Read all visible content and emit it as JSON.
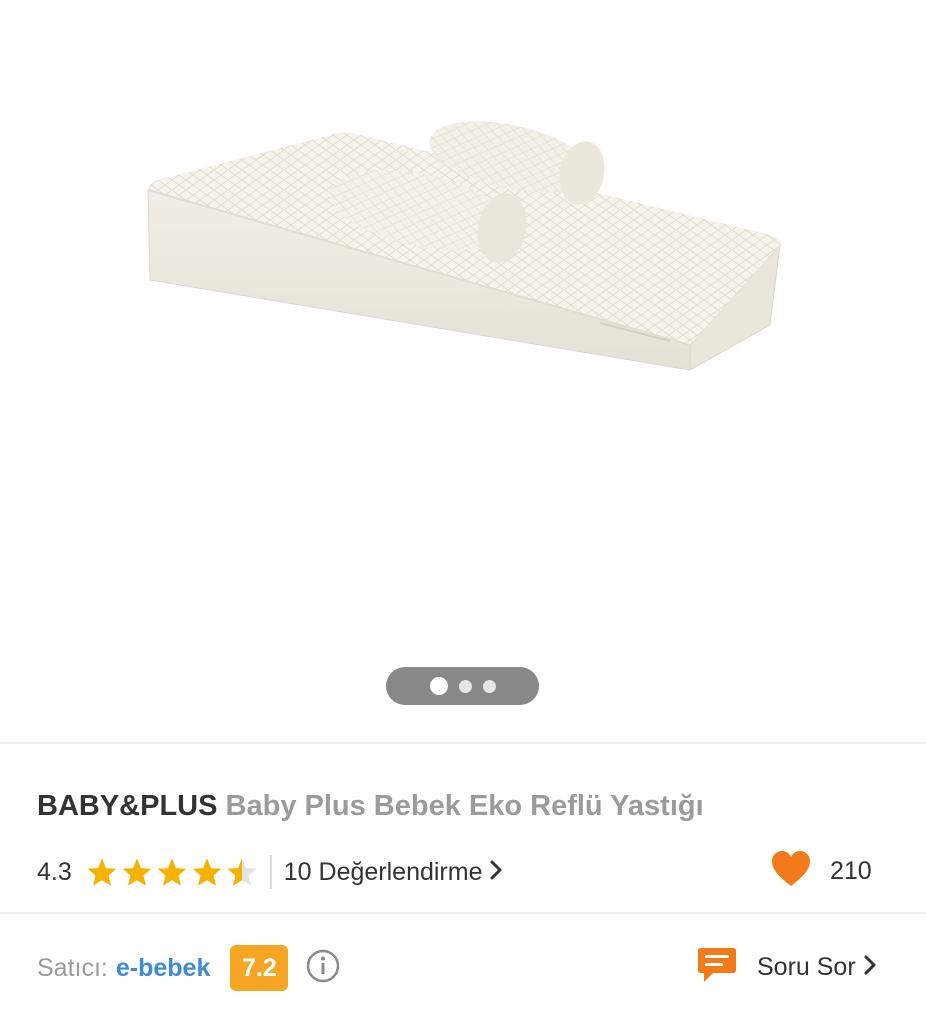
{
  "gallery": {
    "image_alt": "Baby Plus Bebek Eko Reflü Yastığı",
    "pager": {
      "count": 3,
      "active_index": 0
    }
  },
  "product": {
    "brand": "BABY&PLUS",
    "name": "Baby Plus Bebek Eko Reflü Yastığı"
  },
  "rating": {
    "value": "4.3",
    "stars": 4.3,
    "reviews_label": "10 Değerlendirme",
    "star_color": "#f6b200"
  },
  "favorites": {
    "count": "210",
    "heart_color": "#f27a1a"
  },
  "seller": {
    "label": "Satıcı:",
    "name": "e-bebek",
    "score": "7.2",
    "score_color": "#f6a623"
  },
  "ask": {
    "label": "Soru Sor",
    "icon_color": "#f27a1a"
  }
}
